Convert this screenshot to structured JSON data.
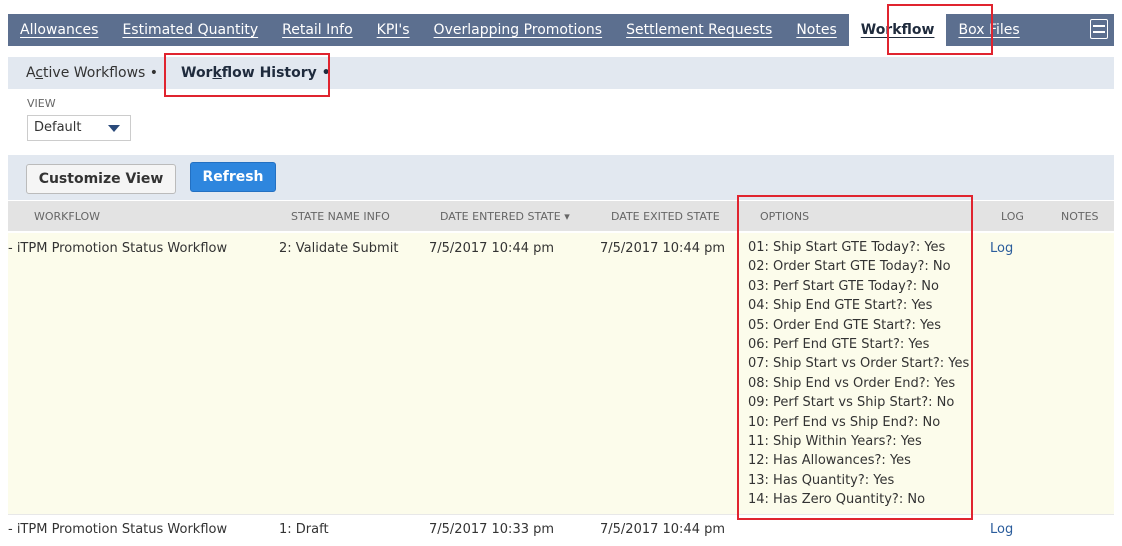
{
  "nav": {
    "tabs": [
      {
        "label": "Allowances"
      },
      {
        "label": "Estimated Quantity"
      },
      {
        "label": "Retail Info"
      },
      {
        "label": "KPI's"
      },
      {
        "label": "Overlapping Promotions"
      },
      {
        "label": "Settlement Requests"
      },
      {
        "label": "Notes"
      },
      {
        "label": "Workflow",
        "active": true
      },
      {
        "label": "Box Files"
      }
    ],
    "menu_icon": "hamburger-menu-icon"
  },
  "subtabs": {
    "active_workflows": {
      "prefix": "A",
      "underline": "c",
      "rest": "tive Workflows",
      "dot": " •"
    },
    "workflow_history": {
      "prefix": "Wor",
      "underline": "k",
      "rest": "flow History",
      "dot": " •"
    }
  },
  "view": {
    "label": "VIEW",
    "selected": "Default"
  },
  "toolbar": {
    "customize_label": "Customize View",
    "refresh_label": "Refresh"
  },
  "table": {
    "headers": {
      "workflow": "WORKFLOW",
      "state": "STATE NAME INFO",
      "entered": "DATE ENTERED STATE ▾",
      "exited": "DATE EXITED STATE",
      "options": "OPTIONS",
      "log": "LOG",
      "notes": "NOTES"
    },
    "rows": [
      {
        "workflow": "- iTPM Promotion Status Workflow",
        "state": "2: Validate Submit",
        "entered": "7/5/2017 10:44 pm",
        "exited": "7/5/2017 10:44 pm",
        "options": [
          "01: Ship Start GTE Today?: Yes",
          "02: Order Start GTE Today?: No",
          "03: Perf Start GTE Today?: No",
          "04: Ship End GTE Start?: Yes",
          "05: Order End GTE Start?: Yes",
          "06: Perf End GTE Start?: Yes",
          "07: Ship Start vs Order Start?: Yes",
          "08: Ship End vs Order End?: Yes",
          "09: Perf Start vs Ship Start?: No",
          "10: Perf End vs Ship End?: No",
          "11: Ship Within Years?: Yes",
          "12: Has Allowances?: Yes",
          "13: Has Quantity?: Yes",
          "14: Has Zero Quantity?: No"
        ],
        "log": "Log"
      },
      {
        "workflow": "- iTPM Promotion Status Workflow",
        "state": "1: Draft",
        "entered": "7/5/2017 10:33 pm",
        "exited": "7/5/2017 10:44 pm",
        "log": "Log"
      }
    ]
  },
  "colors": {
    "nav_bg": "#5c6f8f",
    "highlight": "#e0242f",
    "refresh_bg": "#2e86de",
    "row_highlight": "#fcfceb"
  }
}
